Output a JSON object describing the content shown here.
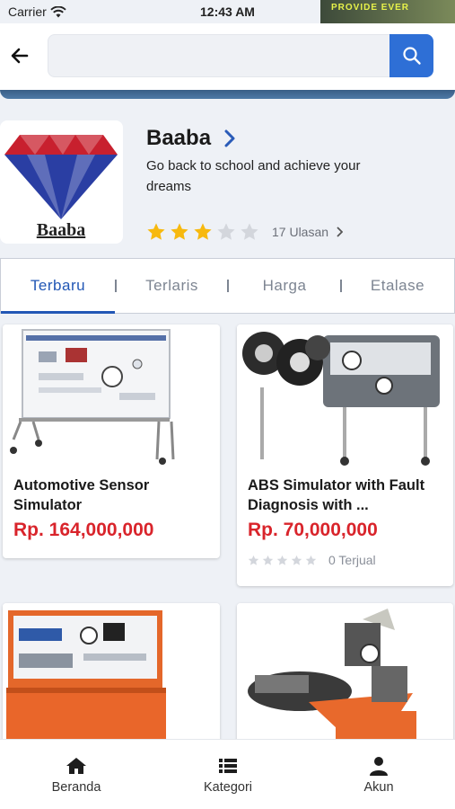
{
  "status_bar": {
    "carrier": "Carrier",
    "time": "12:43 AM",
    "promo_text": "PROVIDE EVER"
  },
  "search": {
    "value": "",
    "placeholder": ""
  },
  "store": {
    "name": "Baaba",
    "logo_text": "Baaba",
    "tagline": "Go back to school and achieve your dreams",
    "rating_stars": 3,
    "rating_max": 5,
    "reviews_label": "17 Ulasan"
  },
  "tabs": [
    {
      "label": "Terbaru",
      "active": true
    },
    {
      "label": "Terlaris",
      "active": false
    },
    {
      "label": "Harga",
      "active": false
    },
    {
      "label": "Etalase",
      "active": false
    }
  ],
  "products": [
    {
      "name": "Automotive Sensor Simulator",
      "price": "Rp. 164,000,000"
    },
    {
      "name": "ABS Simulator with Fault Diagnosis with ...",
      "price": "Rp. 70,000,000",
      "sold_label": "0 Terjual",
      "rating_stars": 0
    },
    {
      "name": "",
      "price": ""
    },
    {
      "name": "",
      "price": ""
    }
  ],
  "bottom_nav": [
    {
      "label": "Beranda",
      "icon": "home-icon"
    },
    {
      "label": "Kategori",
      "icon": "list-icon"
    },
    {
      "label": "Akun",
      "icon": "user-icon"
    }
  ],
  "colors": {
    "primary": "#2e6fd6",
    "tab_active": "#2257b5",
    "price": "#d9242b",
    "star": "#f7b90f",
    "star_empty": "#d3d6dc"
  }
}
